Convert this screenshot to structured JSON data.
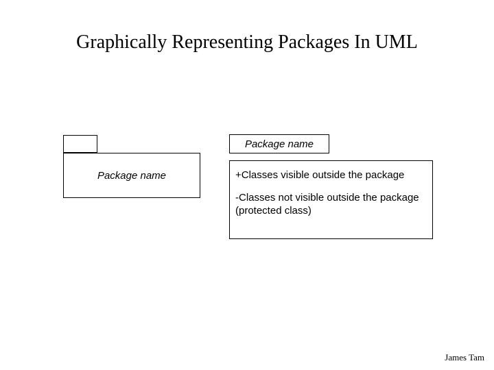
{
  "title": "Graphically Representing Packages In UML",
  "left_package": {
    "label": "Package name"
  },
  "right_package": {
    "tab_label": "Package name",
    "visible_line": "+Classes visible outside the package",
    "hidden_line1": "-Classes not visible outside the package",
    "hidden_line2": "(protected class)"
  },
  "footer": "James Tam"
}
